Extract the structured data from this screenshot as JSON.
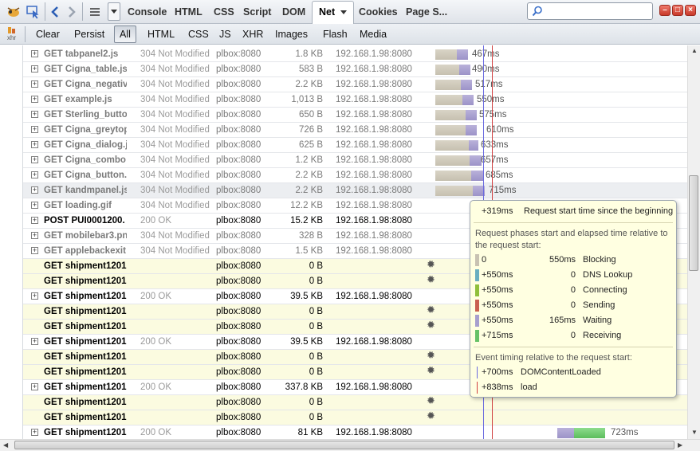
{
  "toolbar": {
    "tabs": [
      "Console",
      "HTML",
      "CSS",
      "Script",
      "DOM",
      "Net",
      "Cookies",
      "Page S..."
    ],
    "active_tab": "Net",
    "search_placeholder": "",
    "window_buttons": [
      "–",
      "□",
      "×"
    ]
  },
  "filter": {
    "xhr_icon_label": "xhr",
    "clear": "Clear",
    "persist": "Persist",
    "types": [
      "All",
      "HTML",
      "CSS",
      "JS",
      "XHR",
      "Images",
      "Flash",
      "Media"
    ],
    "active": "All"
  },
  "colors": {
    "blocking": "#c8c2b2",
    "waiting": "#a79fce",
    "receiving": "#66c266",
    "dns": "#6aaec0",
    "connecting": "#8fbf3a",
    "sending": "#c96050",
    "domcontentloaded_line": "#6a6adf",
    "load_line": "#d04040",
    "loading_row_bg": "#fbfbe0"
  },
  "requests": [
    {
      "url": "GET tabpanel2.js",
      "status": "304 Not Modified",
      "domain": "plbox:8080",
      "size": "1.8 KB",
      "ip": "192.168.1.98:8080",
      "time": "467ms",
      "kind": "cached"
    },
    {
      "url": "GET Cigna_table.js",
      "status": "304 Not Modified",
      "domain": "plbox:8080",
      "size": "583 B",
      "ip": "192.168.1.98:8080",
      "time": "490ms",
      "kind": "cached"
    },
    {
      "url": "GET Cigna_negativ",
      "status": "304 Not Modified",
      "domain": "plbox:8080",
      "size": "2.2 KB",
      "ip": "192.168.1.98:8080",
      "time": "517ms",
      "kind": "cached"
    },
    {
      "url": "GET example.js",
      "status": "304 Not Modified",
      "domain": "plbox:8080",
      "size": "1,013 B",
      "ip": "192.168.1.98:8080",
      "time": "550ms",
      "kind": "cached"
    },
    {
      "url": "GET Sterling_butto",
      "status": "304 Not Modified",
      "domain": "plbox:8080",
      "size": "650 B",
      "ip": "192.168.1.98:8080",
      "time": "575ms",
      "kind": "cached"
    },
    {
      "url": "GET Cigna_greytop",
      "status": "304 Not Modified",
      "domain": "plbox:8080",
      "size": "726 B",
      "ip": "192.168.1.98:8080",
      "time": "610ms",
      "kind": "cached"
    },
    {
      "url": "GET Cigna_dialog.j",
      "status": "304 Not Modified",
      "domain": "plbox:8080",
      "size": "625 B",
      "ip": "192.168.1.98:8080",
      "time": "633ms",
      "kind": "cached"
    },
    {
      "url": "GET Cigna_combo",
      "status": "304 Not Modified",
      "domain": "plbox:8080",
      "size": "1.2 KB",
      "ip": "192.168.1.98:8080",
      "time": "657ms",
      "kind": "cached"
    },
    {
      "url": "GET Cigna_button.",
      "status": "304 Not Modified",
      "domain": "plbox:8080",
      "size": "2.2 KB",
      "ip": "192.168.1.98:8080",
      "time": "685ms",
      "kind": "cached"
    },
    {
      "url": "GET kandmpanel.js",
      "status": "304 Not Modified",
      "domain": "plbox:8080",
      "size": "2.2 KB",
      "ip": "192.168.1.98:8080",
      "time": "715ms",
      "kind": "cached-hover"
    },
    {
      "url": "GET loading.gif",
      "status": "304 Not Modified",
      "domain": "plbox:8080",
      "size": "12.2 KB",
      "ip": "192.168.1.98:8080",
      "time": "",
      "kind": "cached"
    },
    {
      "url": "POST PUI0001200.",
      "status": "200 OK",
      "domain": "plbox:8080",
      "size": "15.2 KB",
      "ip": "192.168.1.98:8080",
      "time": "",
      "kind": "ok"
    },
    {
      "url": "GET mobilebar3.pn",
      "status": "304 Not Modified",
      "domain": "plbox:8080",
      "size": "328 B",
      "ip": "192.168.1.98:8080",
      "time": "",
      "kind": "cached"
    },
    {
      "url": "GET applebackexit",
      "status": "304 Not Modified",
      "domain": "plbox:8080",
      "size": "1.5 KB",
      "ip": "192.168.1.98:8080",
      "time": "",
      "kind": "cached"
    },
    {
      "url": "GET shipment1201",
      "status": "",
      "domain": "plbox:8080",
      "size": "0 B",
      "ip": "",
      "time": "",
      "kind": "loading"
    },
    {
      "url": "GET shipment1201",
      "status": "",
      "domain": "plbox:8080",
      "size": "0 B",
      "ip": "",
      "time": "",
      "kind": "loading"
    },
    {
      "url": "GET shipment1201",
      "status": "200 OK",
      "domain": "plbox:8080",
      "size": "39.5 KB",
      "ip": "192.168.1.98:8080",
      "time": "",
      "kind": "ok"
    },
    {
      "url": "GET shipment1201",
      "status": "",
      "domain": "plbox:8080",
      "size": "0 B",
      "ip": "",
      "time": "",
      "kind": "loading"
    },
    {
      "url": "GET shipment1201",
      "status": "",
      "domain": "plbox:8080",
      "size": "0 B",
      "ip": "",
      "time": "",
      "kind": "loading"
    },
    {
      "url": "GET shipment1201",
      "status": "200 OK",
      "domain": "plbox:8080",
      "size": "39.5 KB",
      "ip": "192.168.1.98:8080",
      "time": "",
      "kind": "ok"
    },
    {
      "url": "GET shipment1201",
      "status": "",
      "domain": "plbox:8080",
      "size": "0 B",
      "ip": "",
      "time": "",
      "kind": "loading"
    },
    {
      "url": "GET shipment1201",
      "status": "",
      "domain": "plbox:8080",
      "size": "0 B",
      "ip": "",
      "time": "",
      "kind": "loading"
    },
    {
      "url": "GET shipment1201",
      "status": "200 OK",
      "domain": "plbox:8080",
      "size": "337.8 KB",
      "ip": "192.168.1.98:8080",
      "time": "",
      "kind": "ok"
    },
    {
      "url": "GET shipment1201",
      "status": "",
      "domain": "plbox:8080",
      "size": "0 B",
      "ip": "",
      "time": "",
      "kind": "loading"
    },
    {
      "url": "GET shipment1201",
      "status": "",
      "domain": "plbox:8080",
      "size": "0 B",
      "ip": "",
      "time": "",
      "kind": "loading"
    },
    {
      "url": "GET shipment1201",
      "status": "200 OK",
      "domain": "plbox:8080",
      "size": "81 KB",
      "ip": "192.168.1.98:8080",
      "time": "723ms",
      "kind": "ok-last"
    }
  ],
  "tooltip": {
    "start": {
      "value": "+319ms",
      "label": "Request start time since the beginning"
    },
    "phases_heading": "Request phases start and elapsed time relative to the request start:",
    "phases": [
      {
        "start": "0",
        "elapsed": "550ms",
        "name": "Blocking",
        "color": "#c8c2b2"
      },
      {
        "start": "+550ms",
        "elapsed": "0",
        "name": "DNS Lookup",
        "color": "#6aaec0"
      },
      {
        "start": "+550ms",
        "elapsed": "0",
        "name": "Connecting",
        "color": "#8fbf3a"
      },
      {
        "start": "+550ms",
        "elapsed": "0",
        "name": "Sending",
        "color": "#c96050"
      },
      {
        "start": "+550ms",
        "elapsed": "165ms",
        "name": "Waiting",
        "color": "#a79fce"
      },
      {
        "start": "+715ms",
        "elapsed": "0",
        "name": "Receiving",
        "color": "#66c266"
      }
    ],
    "events_heading": "Event timing relative to the request start:",
    "events": [
      {
        "time": "+700ms",
        "name": "DOMContentLoaded",
        "color": "#6a6adf"
      },
      {
        "time": "+838ms",
        "name": "load",
        "color": "#d04040"
      }
    ]
  }
}
